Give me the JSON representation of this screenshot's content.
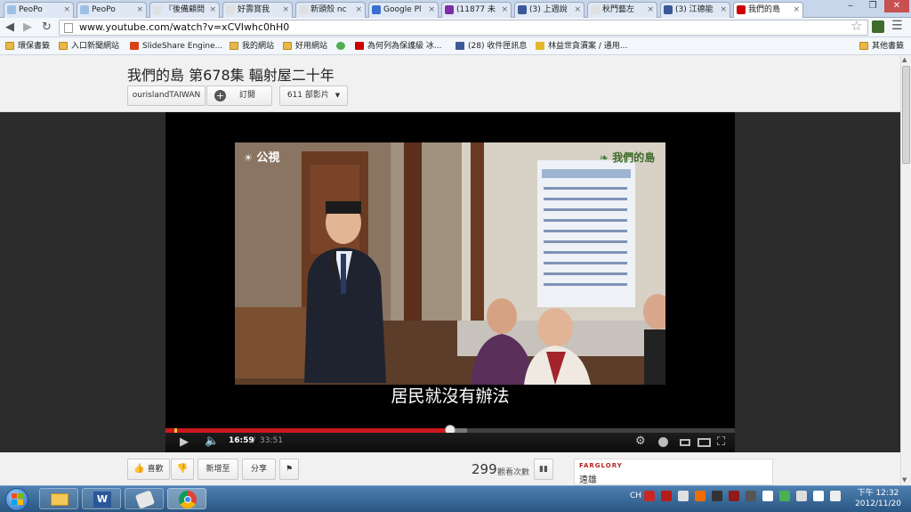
{
  "tabs": [
    {
      "title": "PeoPo",
      "color": "#9ec0e4"
    },
    {
      "title": "PeoPo",
      "color": "#9ec0e4"
    },
    {
      "title": "『後備顧問",
      "color": "#e0e0e0"
    },
    {
      "title": "好壽賞我",
      "color": "#e0e0e0"
    },
    {
      "title": "新頭殼 nc",
      "color": "#e0e0e0"
    },
    {
      "title": "Google Pl",
      "color": "#3b6ed0"
    },
    {
      "title": "(11877 未",
      "color": "#7b2ea8"
    },
    {
      "title": "(3) 上週說",
      "color": "#3b5998"
    },
    {
      "title": "秋門藝左",
      "color": "#e0e0e0"
    },
    {
      "title": "(3) 江德能",
      "color": "#3b5998"
    },
    {
      "title": "我們的島",
      "color": "#cc0000"
    }
  ],
  "window": {
    "min": "‒",
    "max": "❐",
    "close": "✕"
  },
  "url": "www.youtube.com/watch?v=xCVIwhc0hH0",
  "bookmarks": [
    {
      "label": "環保書籤",
      "kind": "folder"
    },
    {
      "label": "入口新聞網站",
      "kind": "folder"
    },
    {
      "label": "SlideShare Engine...",
      "kind": "slideshare"
    },
    {
      "label": "我的網站",
      "kind": "folder"
    },
    {
      "label": "好用網站",
      "kind": "folder"
    },
    {
      "label": "",
      "kind": "green"
    },
    {
      "label": "為何列為保護級 冰...",
      "kind": "youtube"
    },
    {
      "label": "(28) 收件匣訊息",
      "kind": "facebook"
    },
    {
      "label": "林益世貪瀆案 / 通用...",
      "kind": "yellow"
    }
  ],
  "other_bookmarks": "其他書籤",
  "video": {
    "title": "我們的島 第678集 輻射屋二十年",
    "channel": "ourislandTAIWAN",
    "subscribe": "訂閱",
    "videos_count": "611 部影片",
    "subtitle": "居民就沒有辦法",
    "watermark": "公視",
    "show_logo": "我們的島",
    "current_time": "16:59",
    "duration": "33:51",
    "progress": 0.5,
    "buffered": 0.53
  },
  "actions": {
    "like": "喜歡",
    "add_to": "新增至",
    "share": "分享",
    "views_count": "299",
    "views_label": "觀看次數"
  },
  "ad": {
    "brand": "FARGLORY",
    "sub": "遠雄"
  },
  "clock": {
    "time": "下午 12:32",
    "date": "2012/11/20"
  },
  "ime": "CH",
  "colors": {
    "accent": "#cc181e",
    "taskbar": "#2a5783"
  }
}
